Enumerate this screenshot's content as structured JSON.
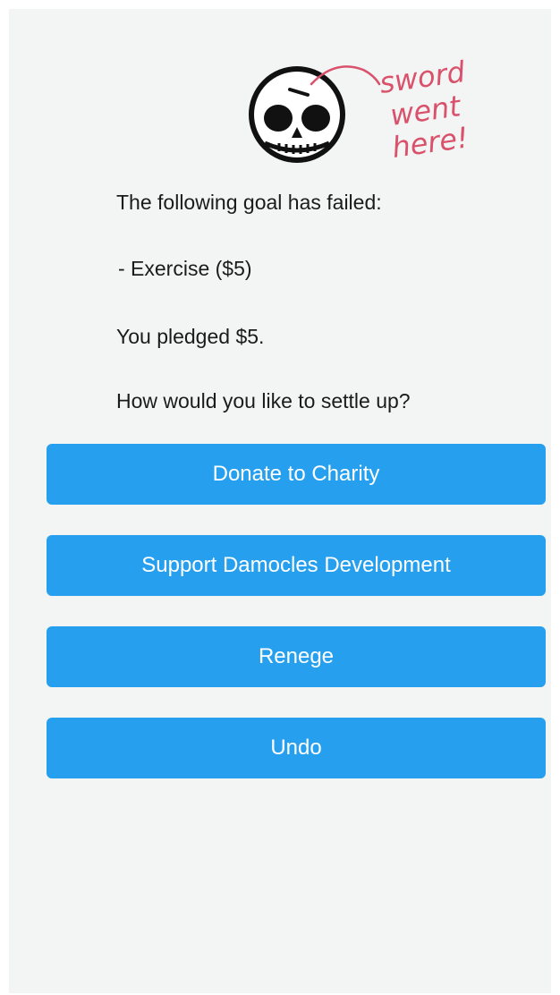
{
  "annotation": {
    "lines": [
      "sword",
      "went",
      "here!"
    ]
  },
  "message": {
    "failed_heading": "The following goal has failed:",
    "goal_item": "- Exercise ($5)",
    "pledge": "You pledged $5.",
    "question": "How would you like to settle up?"
  },
  "actions": {
    "donate_label": "Donate to Charity",
    "support_label": "Support Damocles Development",
    "renege_label": "Renege",
    "undo_label": "Undo"
  },
  "icons": {
    "skull": "skull-icon"
  },
  "colors": {
    "background": "#f3f5f5",
    "button": "#26a0ee",
    "button_text": "#ffffff",
    "annotation": "#d9516b",
    "text": "#1b1b1b"
  }
}
